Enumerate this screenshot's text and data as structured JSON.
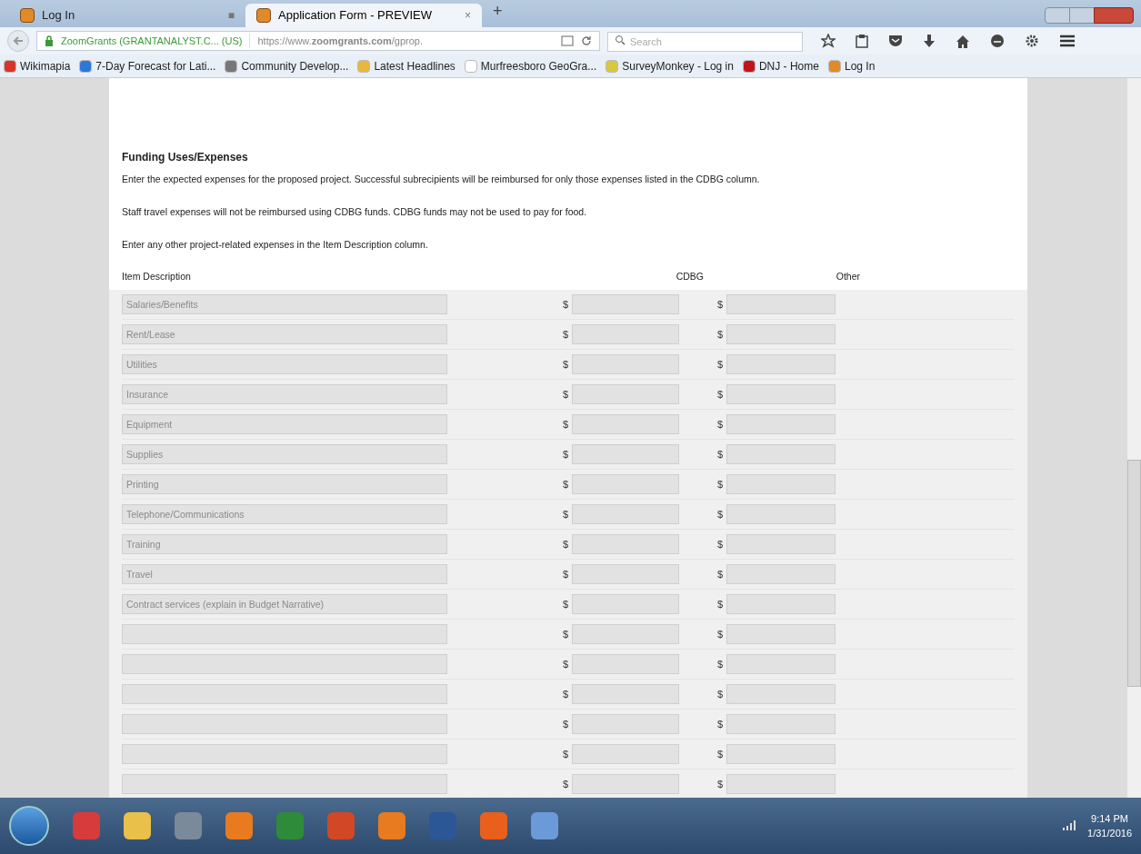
{
  "browser": {
    "tabs": [
      {
        "title": "Log In",
        "close": "■",
        "selected": false
      },
      {
        "title": "Application Form - PREVIEW",
        "close": "×",
        "selected": true
      }
    ],
    "new_tab": "+",
    "address": {
      "identity": "ZoomGrants (GRANTANALYST.C... (US)",
      "url": "https://www.**zoomgrants.com**/gprop."
    },
    "search": {
      "placeholder": "Search"
    },
    "bookmarks": [
      {
        "label": "Wikimapia",
        "color": "#d9342b"
      },
      {
        "label": "7-Day Forecast for Lati...",
        "color": "#2b78d9"
      },
      {
        "label": "Community Develop...",
        "color": "#777777"
      },
      {
        "label": "Latest Headlines",
        "color": "#e8b83a"
      },
      {
        "label": "Murfreesboro GeoGra...",
        "color": "#ffffff"
      },
      {
        "label": "SurveyMonkey - Log in",
        "color": "#d8c840"
      },
      {
        "label": "DNJ - Home",
        "color": "#c0141c"
      },
      {
        "label": "Log In",
        "color": "#e08a2a"
      }
    ]
  },
  "section": {
    "title": "Funding Uses/Expenses",
    "paragraphs": [
      "Enter the expected expenses for the proposed project. Successful subrecipients will be reimbursed for only those expenses listed in the CDBG column.",
      "Staff travel expenses will not be reimbursed using CDBG funds. CDBG funds may not be used to pay for food.",
      "Enter any other project-related expenses in the Item Description column."
    ],
    "columns": [
      "Item Description",
      "CDBG",
      "Other"
    ],
    "rows": [
      {
        "placeholder": "Salaries/Benefits",
        "cdbg_currency": "$",
        "other_currency": "$"
      },
      {
        "placeholder": "Rent/Lease",
        "cdbg_currency": "$",
        "other_currency": "$"
      },
      {
        "placeholder": "Utilities",
        "cdbg_currency": "$",
        "other_currency": "$"
      },
      {
        "placeholder": "Insurance",
        "cdbg_currency": "$",
        "other_currency": "$"
      },
      {
        "placeholder": "Equipment",
        "cdbg_currency": "$",
        "other_currency": "$"
      },
      {
        "placeholder": "Supplies",
        "cdbg_currency": "$",
        "other_currency": "$"
      },
      {
        "placeholder": "Printing",
        "cdbg_currency": "$",
        "other_currency": "$"
      },
      {
        "placeholder": "Telephone/Communications",
        "cdbg_currency": "$",
        "other_currency": "$"
      },
      {
        "placeholder": "Training",
        "cdbg_currency": "$",
        "other_currency": "$"
      },
      {
        "placeholder": "Travel",
        "cdbg_currency": "$",
        "other_currency": "$"
      },
      {
        "placeholder": "Contract services (explain in Budget Narrative)",
        "cdbg_currency": "$",
        "other_currency": "$"
      },
      {
        "cdbg_currency": "$",
        "other_currency": "$"
      },
      {
        "cdbg_currency": "$",
        "other_currency": "$"
      },
      {
        "cdbg_currency": "$",
        "other_currency": "$"
      },
      {
        "cdbg_currency": "$",
        "other_currency": "$"
      },
      {
        "cdbg_currency": "$",
        "other_currency": "$"
      },
      {
        "cdbg_currency": "$",
        "other_currency": "$"
      }
    ]
  },
  "taskbar": {
    "time": "9:14 PM",
    "date": "1/31/2016"
  }
}
